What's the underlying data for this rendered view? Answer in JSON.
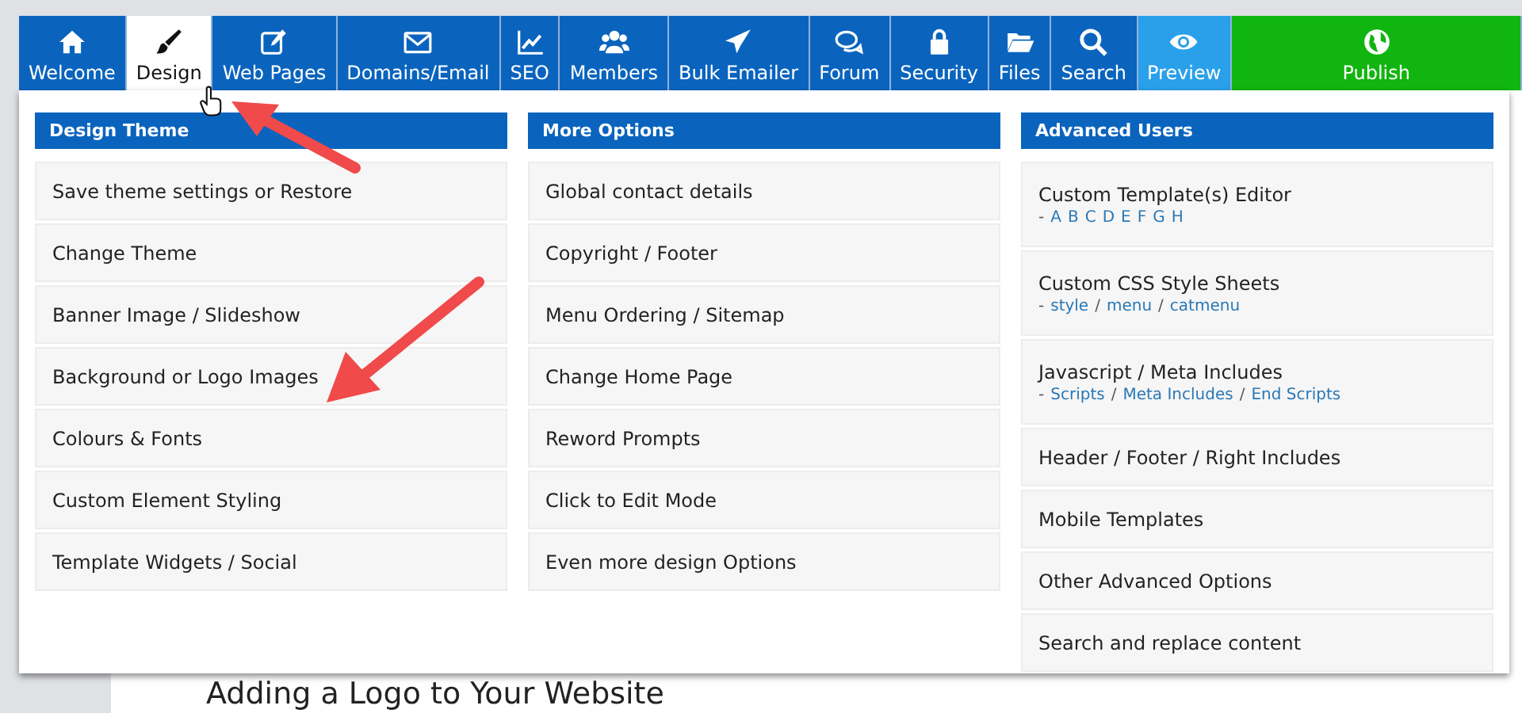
{
  "nav": {
    "tabs": [
      {
        "label": "Welcome",
        "kind": "normal",
        "selected": false
      },
      {
        "label": "Design",
        "kind": "normal",
        "selected": true
      },
      {
        "label": "Web Pages",
        "kind": "normal",
        "selected": false
      },
      {
        "label": "Domains/Email",
        "kind": "normal",
        "selected": false
      },
      {
        "label": "SEO",
        "kind": "normal",
        "selected": false
      },
      {
        "label": "Members",
        "kind": "normal",
        "selected": false
      },
      {
        "label": "Bulk Emailer",
        "kind": "normal",
        "selected": false
      },
      {
        "label": "Forum",
        "kind": "normal",
        "selected": false
      },
      {
        "label": "Security",
        "kind": "normal",
        "selected": false
      },
      {
        "label": "Files",
        "kind": "normal",
        "selected": false
      },
      {
        "label": "Search",
        "kind": "normal",
        "selected": false
      },
      {
        "label": "Preview",
        "kind": "preview",
        "selected": false
      },
      {
        "label": "Publish",
        "kind": "publish",
        "selected": false
      }
    ]
  },
  "menu": {
    "columns": [
      {
        "title": "Design Theme",
        "items": [
          {
            "label": "Save theme settings or Restore"
          },
          {
            "label": "Change Theme"
          },
          {
            "label": "Banner Image / Slideshow"
          },
          {
            "label": "Background or Logo Images"
          },
          {
            "label": "Colours & Fonts"
          },
          {
            "label": "Custom Element Styling"
          },
          {
            "label": "Template Widgets / Social"
          }
        ]
      },
      {
        "title": "More Options",
        "items": [
          {
            "label": "Global contact details"
          },
          {
            "label": "Copyright / Footer"
          },
          {
            "label": "Menu Ordering / Sitemap"
          },
          {
            "label": "Change Home Page"
          },
          {
            "label": "Reword Prompts"
          },
          {
            "label": "Click to Edit Mode"
          },
          {
            "label": "Even more design Options"
          }
        ]
      },
      {
        "title": "Advanced Users",
        "items": [
          {
            "label": "Custom Template(s) Editor",
            "prefix": "-",
            "links": [
              "A",
              "B",
              "C",
              "D",
              "E",
              "F",
              "G",
              "H"
            ]
          },
          {
            "label": "Custom CSS Style Sheets",
            "prefix": "-",
            "separator": "/",
            "links": [
              "style",
              "menu",
              "catmenu"
            ]
          },
          {
            "label": "Javascript / Meta Includes",
            "prefix": "-",
            "separator": "/",
            "links": [
              "Scripts",
              "Meta Includes",
              "End Scripts"
            ]
          },
          {
            "label": "Header / Footer / Right Includes"
          },
          {
            "label": "Mobile Templates"
          },
          {
            "label": "Other Advanced Options"
          },
          {
            "label": "Search and replace content"
          }
        ]
      }
    ]
  },
  "page": {
    "heading": "Adding a Logo to Your Website"
  }
}
